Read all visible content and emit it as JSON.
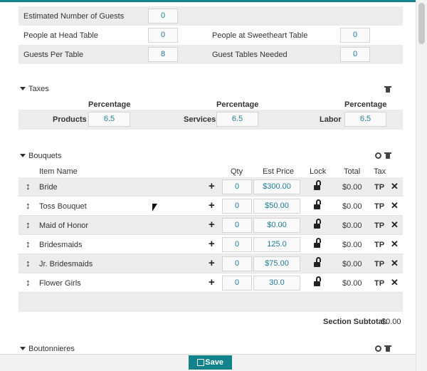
{
  "guests": {
    "estimated_label": "Estimated Number of Guests",
    "estimated_value": "0",
    "head_table_label": "People at Head Table",
    "head_table_value": "0",
    "sweetheart_label": "People at Sweetheart Table",
    "sweetheart_value": "0",
    "per_table_label": "Guests Per Table",
    "per_table_value": "8",
    "tables_needed_label": "Guest Tables Needed",
    "tables_needed_value": "0"
  },
  "taxes": {
    "title": "Taxes",
    "percentage_header": "Percentage",
    "items": [
      {
        "label": "Products",
        "value": "6.5"
      },
      {
        "label": "Services",
        "value": "6.5"
      },
      {
        "label": "Labor",
        "value": "6.5"
      }
    ]
  },
  "bouquets": {
    "title": "Bouquets",
    "columns": {
      "item": "Item Name",
      "qty": "Qty",
      "price": "Est Price",
      "lock": "Lock",
      "total": "Total",
      "tax": "Tax"
    },
    "rows": [
      {
        "name": "Bride",
        "qty": "0",
        "price": "$300.00",
        "total": "$0.00",
        "tax": "TP"
      },
      {
        "name": "Toss Bouquet",
        "qty": "0",
        "price": "$50.00",
        "total": "$0.00",
        "tax": "TP"
      },
      {
        "name": "Maid of Honor",
        "qty": "0",
        "price": "$0.00",
        "total": "$0.00",
        "tax": "TP"
      },
      {
        "name": "Bridesmaids",
        "qty": "0",
        "price": "125.0",
        "total": "$0.00",
        "tax": "TP"
      },
      {
        "name": "Jr. Bridesmaids",
        "qty": "0",
        "price": "$75.00",
        "total": "$0.00",
        "tax": "TP"
      },
      {
        "name": "Flower Girls",
        "qty": "0",
        "price": "30.0",
        "total": "$0.00",
        "tax": "TP"
      }
    ],
    "subtotal_label": "Section Subtotal:",
    "subtotal_value": "$0.00"
  },
  "boutonnieres": {
    "title": "Boutonnieres"
  },
  "footer": {
    "save_label": "Save"
  },
  "icons": {
    "drag": "drag-handle-icon",
    "add": "plus-icon",
    "lock": "unlocked-padlock-icon",
    "remove": "close-icon",
    "delete": "trash-icon",
    "settings": "gear-icon",
    "save": "floppy-disk-icon"
  },
  "colors": {
    "accent": "#12828b",
    "input_text": "#1f7c99",
    "row_shade": "#ececec"
  }
}
